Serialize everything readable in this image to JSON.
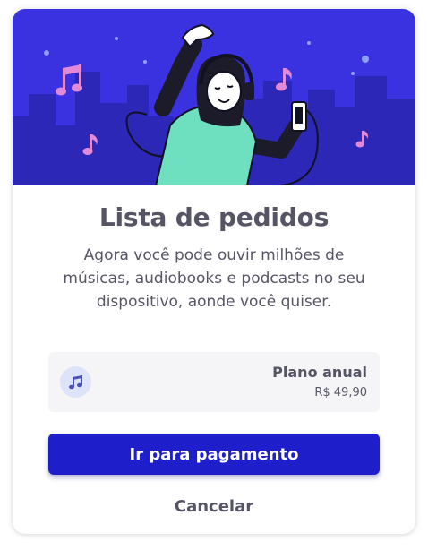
{
  "dialog": {
    "title": "Lista de pedidos",
    "description": "Agora você pode ouvir milhões de músicas, audiobooks e podcasts no seu dispositivo, aonde você quiser."
  },
  "plan": {
    "icon": "music-note-icon",
    "name": "Plano anual",
    "price": "R$ 49,90"
  },
  "actions": {
    "pay_label": "Ir para pagamento",
    "cancel_label": "Cancelar"
  },
  "colors": {
    "accent": "#1e1ecb",
    "hero_background": "#3a32e0",
    "text": "#555566",
    "note": "#e28ad8",
    "shirt": "#6ee0c0"
  }
}
